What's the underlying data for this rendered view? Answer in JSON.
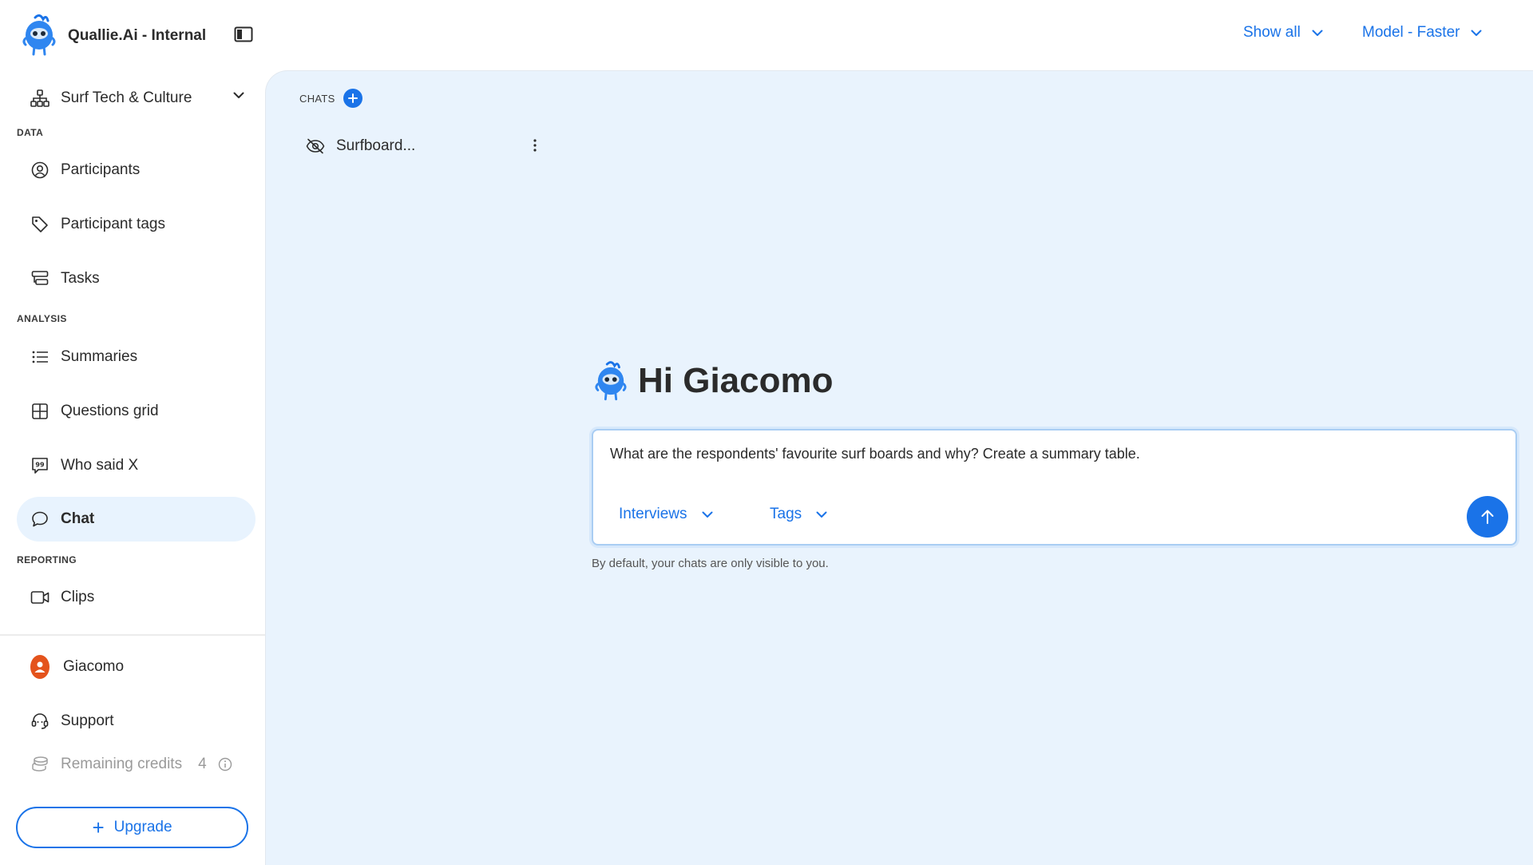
{
  "app": {
    "name": "Quallie.Ai - Internal",
    "logo_icon": "quallie-mascot-icon"
  },
  "header": {
    "show_all": {
      "label": "Show all",
      "icon": "chevron-down-icon"
    },
    "model": {
      "label": "Model - Faster",
      "icon": "chevron-down-icon"
    },
    "sidebar_toggle_icon": "sidebar-toggle-icon"
  },
  "sidebar": {
    "project": {
      "label": "Surf Tech & Culture",
      "icon": "hierarchy-icon"
    },
    "sections": {
      "data": "DATA",
      "analysis": "ANALYSIS",
      "reporting": "REPORTING"
    },
    "items": [
      {
        "label": "Participants",
        "icon": "user-circle-icon",
        "active": false
      },
      {
        "label": "Participant tags",
        "icon": "tag-icon",
        "active": false
      },
      {
        "label": "Tasks",
        "icon": "tasks-icon",
        "active": false
      },
      {
        "label": "Summaries",
        "icon": "list-icon",
        "active": false
      },
      {
        "label": "Questions grid",
        "icon": "grid-icon",
        "active": false
      },
      {
        "label": "Who said X",
        "icon": "quote-icon",
        "active": false
      },
      {
        "label": "Chat",
        "icon": "chat-bubble-icon",
        "active": true
      },
      {
        "label": "Clips",
        "icon": "video-icon",
        "active": false
      }
    ],
    "user": {
      "label": "Giacomo",
      "icon": "avatar-icon"
    },
    "support": {
      "label": "Support",
      "icon": "headset-icon"
    },
    "credits": {
      "label": "Remaining credits",
      "value": "4",
      "icon": "coins-icon",
      "info_icon": "info-icon"
    },
    "upgrade": {
      "label": "Upgrade",
      "icon": "plus-icon"
    }
  },
  "main": {
    "chats": {
      "label": "CHATS",
      "add_icon": "plus-icon",
      "list": [
        {
          "title": "Surfboard...",
          "icon": "eye-off-icon",
          "menu_icon": "more-vertical-icon"
        }
      ]
    },
    "greeting": "Hi Giacomo",
    "composer": {
      "value": "What are the respondents' favourite surf boards and why? Create a summary table.",
      "filters": [
        {
          "label": "Interviews"
        },
        {
          "label": "Tags"
        }
      ],
      "send_icon": "arrow-up-icon"
    },
    "visibility_note": "By default, your chats are only visible to you."
  },
  "colors": {
    "accent": "#1a73e8",
    "main_background": "#e9f3fd",
    "active_nav": "#e8f3fe",
    "avatar": "#e4531c"
  }
}
